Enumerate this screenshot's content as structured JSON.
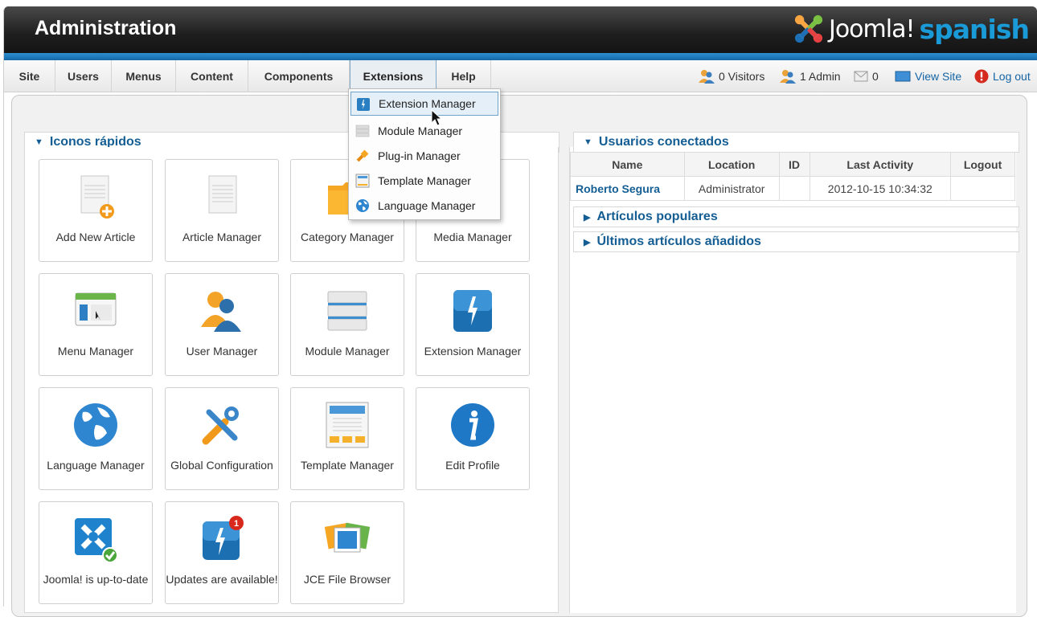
{
  "header": {
    "title": "Administration",
    "logo_word": "Joomla!",
    "logo_lang": "spanish"
  },
  "menu": {
    "items": [
      {
        "label": "Site"
      },
      {
        "label": "Users"
      },
      {
        "label": "Menus"
      },
      {
        "label": "Content"
      },
      {
        "label": "Components"
      },
      {
        "label": "Extensions"
      },
      {
        "label": "Help"
      }
    ],
    "active": "Extensions"
  },
  "status": {
    "visitors": "0 Visitors",
    "admin": "1 Admin",
    "messages": "0",
    "view_site": "View Site",
    "logout": "Log out"
  },
  "dropdown": {
    "items": [
      {
        "label": "Extension Manager",
        "icon": "extension-icon"
      },
      {
        "label": "Module Manager",
        "icon": "module-icon"
      },
      {
        "label": "Plug-in Manager",
        "icon": "plugin-icon"
      },
      {
        "label": "Template Manager",
        "icon": "template-icon"
      },
      {
        "label": "Language Manager",
        "icon": "language-icon"
      }
    ]
  },
  "quick_icons": {
    "title": "Iconos rápidos",
    "tiles": [
      {
        "label": "Add New Article",
        "icon": "add-article-icon"
      },
      {
        "label": "Article Manager",
        "icon": "article-icon"
      },
      {
        "label": "Category Manager",
        "icon": "folder-icon"
      },
      {
        "label": "Media Manager",
        "icon": "media-icon"
      },
      {
        "label": "Menu Manager",
        "icon": "menu-icon"
      },
      {
        "label": "User Manager",
        "icon": "users-icon"
      },
      {
        "label": "Module Manager",
        "icon": "module-icon"
      },
      {
        "label": "Extension Manager",
        "icon": "extension-icon"
      },
      {
        "label": "Language Manager",
        "icon": "globe-icon"
      },
      {
        "label": "Global Configuration",
        "icon": "tools-icon"
      },
      {
        "label": "Template Manager",
        "icon": "template-icon"
      },
      {
        "label": "Edit Profile",
        "icon": "info-icon"
      },
      {
        "label": "Joomla! is up-to-date",
        "icon": "joomla-check-icon"
      },
      {
        "label": "Updates are available!",
        "icon": "updates-icon",
        "badge": "1"
      },
      {
        "label": "JCE File Browser",
        "icon": "file-browser-icon"
      }
    ]
  },
  "logged_users": {
    "title": "Usuarios conectados",
    "columns": [
      "Name",
      "Location",
      "ID",
      "Last Activity",
      "Logout"
    ],
    "rows": [
      {
        "name": "Roberto Segura",
        "location": "Administrator",
        "id": "",
        "last_activity": "2012-10-15 10:34:32",
        "logout": ""
      }
    ]
  },
  "popular": {
    "title": "Artículos populares"
  },
  "latest": {
    "title": "Últimos artículos añadidos"
  }
}
